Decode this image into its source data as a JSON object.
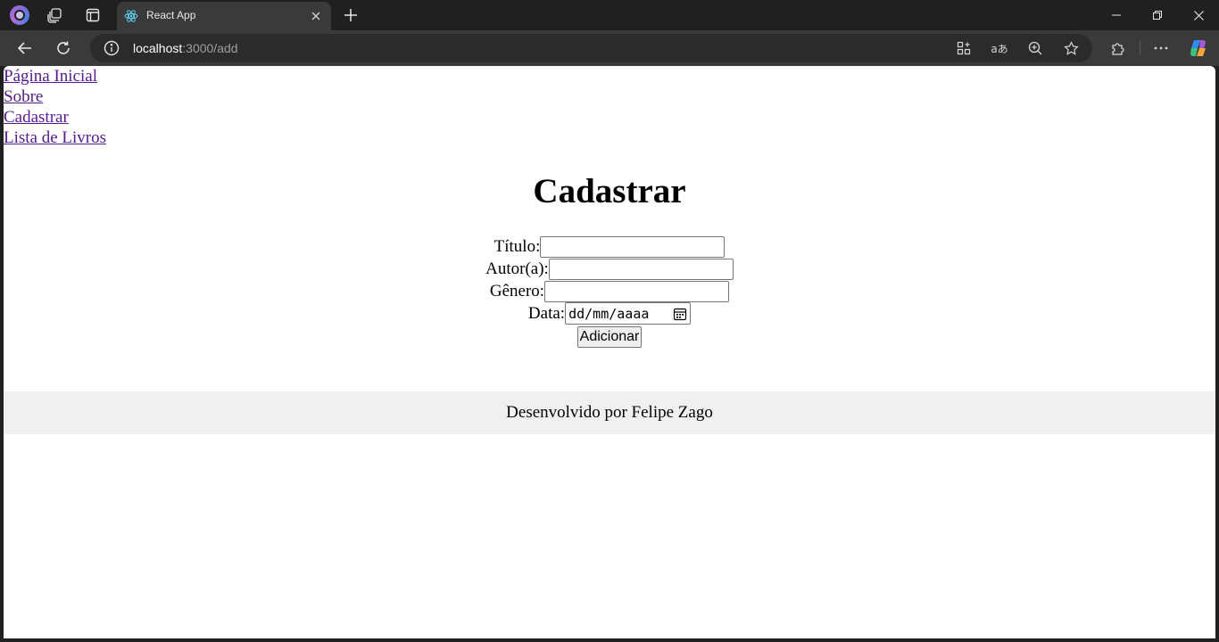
{
  "browser": {
    "tab_title": "React App",
    "url_host": "localhost",
    "url_path": ":3000/add",
    "translate_glyph": "aあ"
  },
  "nav": {
    "links": [
      "Página Inicial",
      "Sobre",
      "Cadastrar",
      "Lista de Livros"
    ]
  },
  "page": {
    "title": "Cadastrar"
  },
  "form": {
    "title_label": "Título:",
    "author_label": "Autor(a):",
    "genre_label": "Gênero:",
    "date_label": "Data:",
    "date_placeholder": "dd/mm/aaaa",
    "submit_label": "Adicionar"
  },
  "footer": {
    "text": "Desenvolvido por Felipe Zago"
  },
  "colors": {
    "link_visited": "#551a8b",
    "footer_bg": "#f0f0f0",
    "chrome_dark": "#202020",
    "toolbar": "#3a3a3a"
  }
}
